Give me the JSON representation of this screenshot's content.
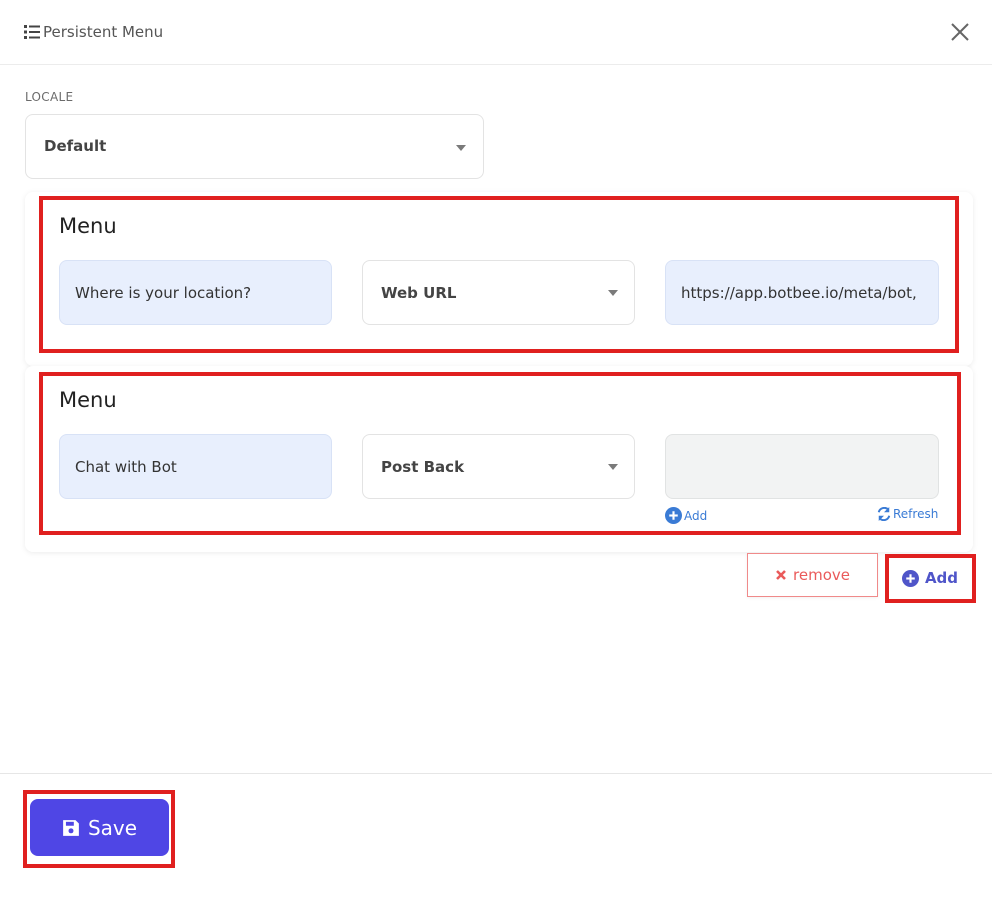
{
  "header": {
    "title": "Persistent Menu",
    "icon": "list-icon",
    "close_icon": "close-icon"
  },
  "locale": {
    "label": "LOCALE",
    "value": "Default"
  },
  "menus": [
    {
      "title": "Menu",
      "text_value": "Where is your location?",
      "type_value": "Web URL",
      "payload_value": "https://app.botbee.io/meta/bot,",
      "payload_empty": false
    },
    {
      "title": "Menu",
      "text_value": "Chat with Bot",
      "type_value": "Post Back",
      "payload_value": "",
      "payload_empty": true,
      "add_label": "Add",
      "refresh_label": "Refresh"
    }
  ],
  "actions": {
    "remove_label": "remove",
    "add_label": "Add",
    "save_label": "Save"
  },
  "colors": {
    "primary": "#4f46e5",
    "add_text": "#4f55c9",
    "remove_text": "#ea5a5a",
    "highlight": "#e0201f",
    "input_bg": "#e8effd",
    "link": "#3a7bd5"
  }
}
